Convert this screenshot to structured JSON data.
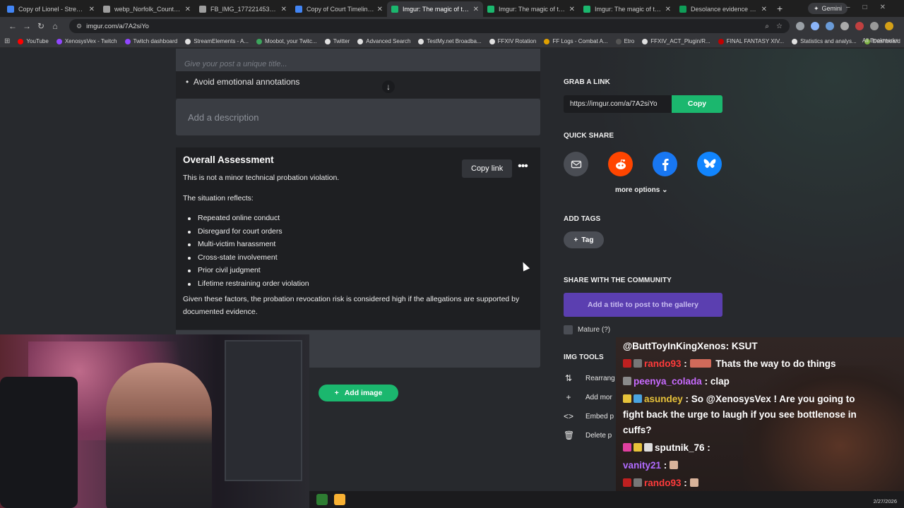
{
  "browser": {
    "tabs": [
      {
        "label": "Copy of Lionel - Stream/Youtu",
        "color": "#4285f4"
      },
      {
        "label": "webp_Norfolk_County_Correc",
        "color": "#9e9e9e"
      },
      {
        "label": "FB_IMG_1772214531415.jpg (",
        "color": "#9e9e9e"
      },
      {
        "label": "Copy of Court Timeline - Goo",
        "color": "#4285f4"
      },
      {
        "label": "Imgur: The magic of the Intern",
        "color": "#1bb76e"
      },
      {
        "label": "Imgur: The magic of the Intern",
        "color": "#1bb76e"
      },
      {
        "label": "Imgur: The magic of the Intern",
        "color": "#1bb76e"
      },
      {
        "label": "Desolance evidence sheet - G",
        "color": "#0f9d58"
      }
    ],
    "active_tab": 4,
    "gemini_label": "Gemini",
    "url": "imgur.com/a/7A2siYo",
    "bookmarks": [
      {
        "label": "YouTube",
        "color": "#ff0000"
      },
      {
        "label": "XenosysVex - Twitch",
        "color": "#9146ff"
      },
      {
        "label": "Twitch dashboard",
        "color": "#9146ff"
      },
      {
        "label": "StreamElements - A...",
        "color": "#e0e0e0"
      },
      {
        "label": "Moobot, your Twitc...",
        "color": "#3ca55c"
      },
      {
        "label": "Twitter",
        "color": "#e0e0e0"
      },
      {
        "label": "Advanced Search",
        "color": "#e0e0e0"
      },
      {
        "label": "TestMy.net Broadba...",
        "color": "#e0e0e0"
      },
      {
        "label": "FFXIV Rotation",
        "color": "#e0e0e0"
      },
      {
        "label": "FF Logs - Combat A...",
        "color": "#e0a000"
      },
      {
        "label": "Etro",
        "color": "#333"
      },
      {
        "label": "FFXIV_ACT_Plugin/R...",
        "color": "#e0e0e0"
      },
      {
        "label": "FINAL FANTASY XIV...",
        "color": "#c00000"
      },
      {
        "label": "Statistics and analys...",
        "color": "#e0e0e0"
      },
      {
        "label": "Dashboard",
        "color": "#7cb342"
      }
    ],
    "all_bookmarks": "All Bookmarks"
  },
  "post": {
    "title_placeholder": "Give your post a unique title...",
    "prev_bullet": "Avoid emotional annotations",
    "description_placeholder": "Add a description",
    "assessment_title": "Overall Assessment",
    "copy_link": "Copy link",
    "more": "•••",
    "intro": "This is not a minor technical probation violation.",
    "situation": "The situation reflects:",
    "factors": [
      "Repeated online conduct",
      "Disregard for court orders",
      "Multi-victim harassment",
      "Cross-state involvement",
      "Prior civil judgment",
      "Lifetime restraining order violation"
    ],
    "conclusion": "Given these factors, the probation revocation risk is considered high if the allegations are supported by documented evidence.",
    "add_image": "Add image"
  },
  "sidebar": {
    "grab_link": "GRAB A LINK",
    "link": "https://imgur.com/a/7A2siYo",
    "copy": "Copy",
    "quick_share": "QUICK SHARE",
    "share_icons": [
      "email-icon",
      "reddit-icon",
      "facebook-icon",
      "bluesky-icon"
    ],
    "more_options": "more options",
    "add_tags": "ADD TAGS",
    "tag": "Tag",
    "share_community": "SHARE WITH THE COMMUNITY",
    "gallery_button": "Add a title to post to the gallery",
    "mature": "Mature (?)",
    "img_tools": "IMG TOOLS",
    "tools": [
      "Rearrang",
      "Add mor",
      "Embed p",
      "Delete p"
    ]
  },
  "chat": [
    {
      "user": "@ButtToyInKingXenos",
      "sep": ": ",
      "msg": "KSUT",
      "color": "#ffffff"
    },
    {
      "user": "rando93",
      "sep": " : ",
      "msg": "Thats the way to do things",
      "color": "#ff3b3b"
    },
    {
      "user": "peenya_colada",
      "sep": " : ",
      "msg": "clap",
      "color": "#c86bff"
    },
    {
      "user": "asundey",
      "sep": " : ",
      "msg": "So @XenosysVex ! Are you going to fight back the urge to laugh if you see bottlenose in cuffs?",
      "color": "#e7c23a"
    },
    {
      "user": "sputnik_76",
      "sep": " : ",
      "msg": "",
      "color": "#ffffff"
    },
    {
      "user": "vanity21",
      "sep": " : ",
      "msg": "",
      "color": "#b16bff"
    },
    {
      "user": "rando93",
      "sep": " : ",
      "msg": "",
      "color": "#ff3b3b"
    }
  ],
  "taskbar": {
    "date": "2/27/2026"
  }
}
